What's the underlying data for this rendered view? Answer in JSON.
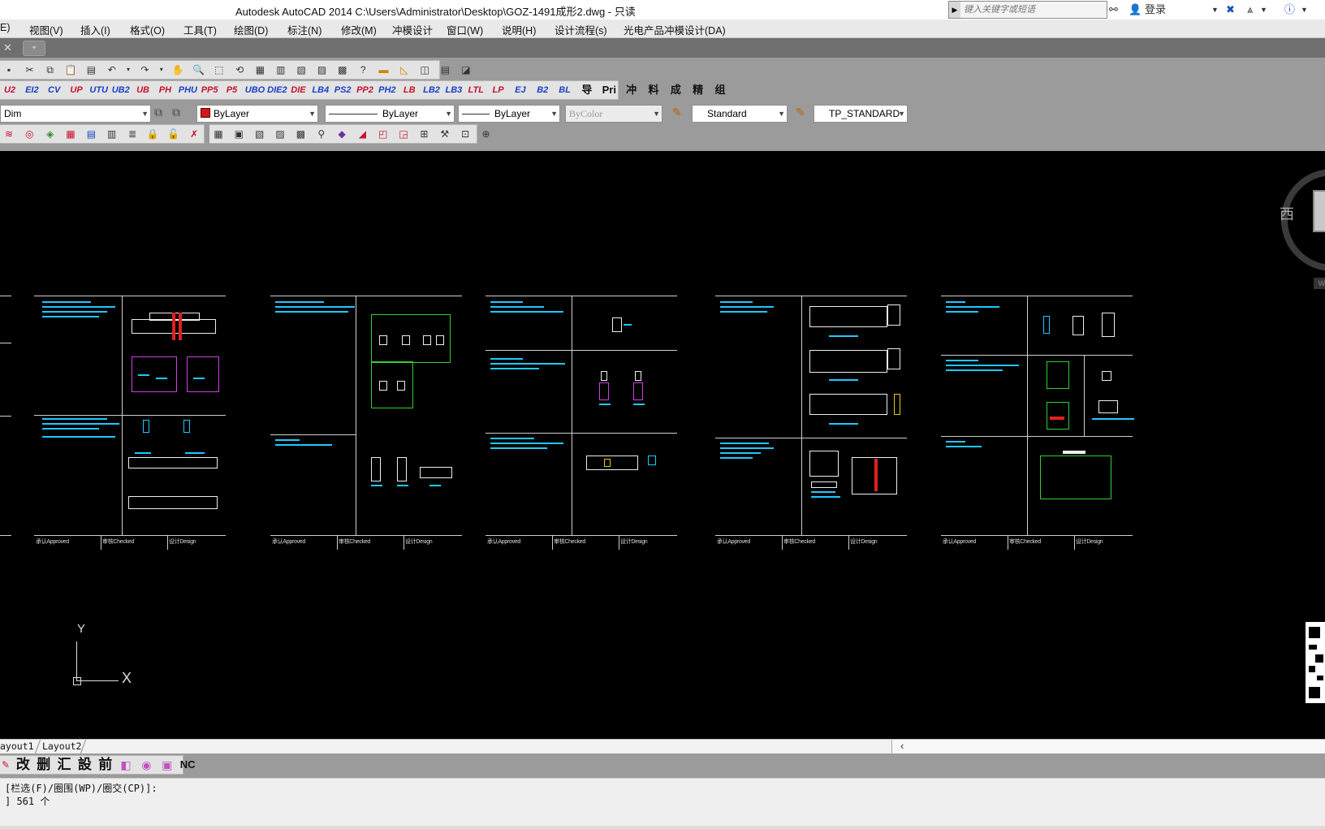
{
  "window": {
    "title": "Autodesk AutoCAD 2014    C:\\Users\\Administrator\\Desktop\\GOZ-1491成形2.dwg - 只读",
    "search_placeholder": "键入关键字或短语",
    "login_label": "登录"
  },
  "menu": [
    {
      "label": "E)"
    },
    {
      "label": "视图(V)"
    },
    {
      "label": "插入(I)"
    },
    {
      "label": "格式(O)"
    },
    {
      "label": "工具(T)"
    },
    {
      "label": "绘图(D)"
    },
    {
      "label": "标注(N)"
    },
    {
      "label": "修改(M)"
    },
    {
      "label": "冲模设计"
    },
    {
      "label": "窗口(W)"
    },
    {
      "label": "说明(H)"
    },
    {
      "label": "设计流程(s)"
    },
    {
      "label": "光电产品冲模设计(DA)"
    }
  ],
  "plugin_toolbar": {
    "buttons": [
      "U2",
      "EI2",
      "CV",
      "UP",
      "UTU",
      "UB2",
      "UB",
      "PH",
      "PHU",
      "PP5",
      "P5",
      "UBO",
      "DIE2",
      "DIE",
      "LB4",
      "PS2",
      "PP2",
      "PH2",
      "LB",
      "LB2",
      "LB3",
      "LTL",
      "LP",
      "EJ",
      "B2",
      "BL",
      "导",
      "Pri",
      "冲",
      "料",
      "成",
      "精",
      "组"
    ]
  },
  "properties": {
    "layer": "Dim",
    "color": "ByLayer",
    "linetype": "ByLayer",
    "lineweight": "ByLayer",
    "plotstyle": "ByColor",
    "textstyle": "Standard",
    "dimstyle": "TP_STANDARD"
  },
  "viewcube": {
    "label": "西",
    "wcs": "W"
  },
  "sheets": [
    {
      "approve": "承认Approved",
      "check": "审核Checked",
      "design": "设计Design"
    },
    {
      "approve": "承认Approved",
      "check": "审核Checked",
      "design": "设计Design"
    },
    {
      "approve": "承认Approved",
      "check": "审核Checked",
      "design": "设计Design"
    },
    {
      "approve": "承认Approved",
      "check": "审核Checked",
      "design": "设计Design"
    },
    {
      "approve": "承认Approved",
      "check": "审核Checked",
      "design": "设计Design"
    }
  ],
  "ucs": {
    "x": "X",
    "y": "Y"
  },
  "layout_tabs": [
    {
      "label": "ayout1"
    },
    {
      "label": "Layout2"
    }
  ],
  "bottom_toolbar": [
    "改",
    "删",
    "汇",
    "設",
    "前"
  ],
  "command": {
    "line1": "[栏选(F)/圈围(WP)/圈交(CP)]:",
    "line2": "] 561 个"
  },
  "colors": {
    "canvas": "#000000",
    "text_cyan": "#1ec8ff",
    "frame": "#cfcfcf",
    "magenta": "#d040e0",
    "green": "#30d030",
    "red": "#e02020"
  }
}
